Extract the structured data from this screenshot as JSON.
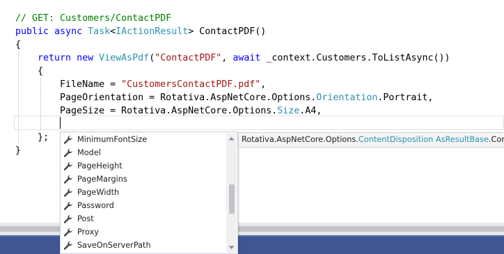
{
  "editor": {
    "lines": [
      [
        {
          "t": "// GET: Customers/ContactPDF",
          "c": "comment"
        }
      ],
      [
        {
          "t": "public",
          "c": "keyword"
        },
        {
          "t": " ",
          "c": "plain"
        },
        {
          "t": "async",
          "c": "keyword"
        },
        {
          "t": " ",
          "c": "plain"
        },
        {
          "t": "Task",
          "c": "type"
        },
        {
          "t": "<",
          "c": "plain"
        },
        {
          "t": "IActionResult",
          "c": "type"
        },
        {
          "t": "> ContactPDF()",
          "c": "plain"
        }
      ],
      [
        {
          "t": "{",
          "c": "plain"
        }
      ],
      [
        {
          "t": "    ",
          "c": "plain"
        },
        {
          "t": "return",
          "c": "keyword"
        },
        {
          "t": " ",
          "c": "plain"
        },
        {
          "t": "new",
          "c": "keyword"
        },
        {
          "t": " ",
          "c": "plain"
        },
        {
          "t": "ViewAsPdf",
          "c": "type"
        },
        {
          "t": "(",
          "c": "plain"
        },
        {
          "t": "\"ContactPDF\"",
          "c": "string"
        },
        {
          "t": ", ",
          "c": "plain"
        },
        {
          "t": "await",
          "c": "keyword"
        },
        {
          "t": " _context.Customers.ToListAsync())",
          "c": "plain"
        }
      ],
      [
        {
          "t": "    {",
          "c": "plain"
        }
      ],
      [
        {
          "t": "        FileName = ",
          "c": "plain"
        },
        {
          "t": "\"CustomersContactPDF.pdf\"",
          "c": "string"
        },
        {
          "t": ",",
          "c": "plain"
        }
      ],
      [
        {
          "t": "        PageOrientation = Rotativa.AspNetCore.Options.",
          "c": "plain"
        },
        {
          "t": "Orientation",
          "c": "type"
        },
        {
          "t": ".Portrait,",
          "c": "plain"
        }
      ],
      [
        {
          "t": "        PageSize = Rotativa.AspNetCore.Options.",
          "c": "plain"
        },
        {
          "t": "Size",
          "c": "type"
        },
        {
          "t": ".A4,",
          "c": "plain"
        }
      ],
      [
        {
          "t": "",
          "c": "plain"
        }
      ],
      [
        {
          "t": "    };",
          "c": "plain"
        }
      ],
      [
        {
          "t": "}",
          "c": "plain"
        }
      ]
    ]
  },
  "completion": {
    "icon": "wrench-icon",
    "items": [
      "MinimumFontSize",
      "Model",
      "PageHeight",
      "PageMargins",
      "PageWidth",
      "Password",
      "Post",
      "Proxy",
      "SaveOnServerPath"
    ]
  },
  "tooltip": {
    "prefix": "Rotativa.AspNetCore.Options.",
    "type_name": "ContentDisposition",
    "space": " ",
    "base_type": "AsResultBase",
    "suffix": ".Content"
  },
  "colors": {
    "comment": "#008000",
    "keyword": "#0000ff",
    "type": "#2b91af",
    "string": "#a31515",
    "statusbar": "#3f5692"
  }
}
